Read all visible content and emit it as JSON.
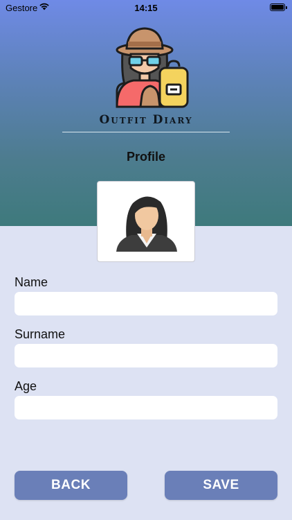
{
  "status_bar": {
    "carrier": "Gestore",
    "time": "14:15"
  },
  "header": {
    "app_name": "Outfit Diary",
    "title": "Profile"
  },
  "form": {
    "name": {
      "label": "Name",
      "value": "",
      "placeholder": ""
    },
    "surname": {
      "label": "Surname",
      "value": "",
      "placeholder": ""
    },
    "age": {
      "label": "Age",
      "value": "",
      "placeholder": ""
    }
  },
  "buttons": {
    "back": "BACK",
    "save": "SAVE"
  },
  "colors": {
    "header_top": "#6f8ae6",
    "header_bottom": "#3e7a7c",
    "background": "#dde2f3",
    "button": "#6a7fb8",
    "input": "#ffffff"
  },
  "icons": {
    "logo": "traveler-woman-logo",
    "avatar": "woman-avatar-icon",
    "wifi": "wifi-icon",
    "battery": "battery-icon"
  }
}
